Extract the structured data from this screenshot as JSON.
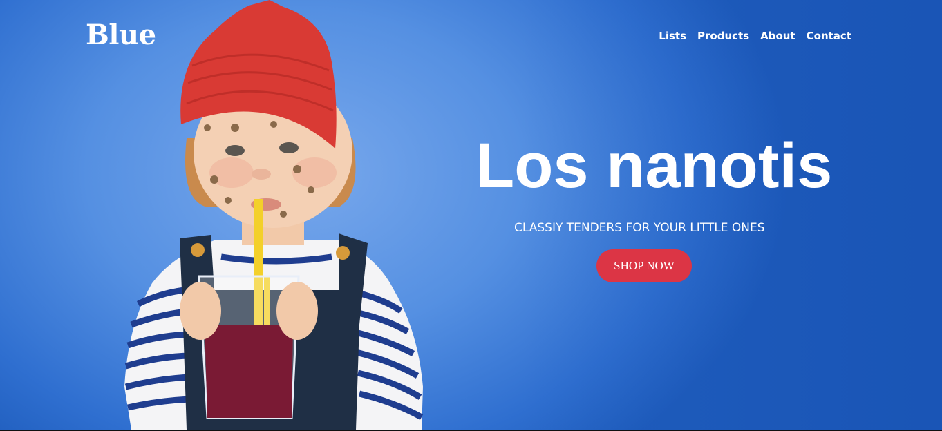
{
  "brand": {
    "name": "Blue"
  },
  "nav": {
    "items": [
      {
        "label": "Lists"
      },
      {
        "label": "Products"
      },
      {
        "label": "About"
      },
      {
        "label": "Contact"
      }
    ]
  },
  "hero": {
    "title": "Los nanotis",
    "subtitle": "CLASSIY TENDERS FOR YOUR LITTLE ONES",
    "cta_label": "SHOP NOW",
    "image_subject": "child-with-red-beanie-drinking-juice"
  },
  "colors": {
    "background": "#4f8ae0",
    "cta": "#dc3545",
    "hat": "#d93a34",
    "straw": "#f3d02a"
  }
}
